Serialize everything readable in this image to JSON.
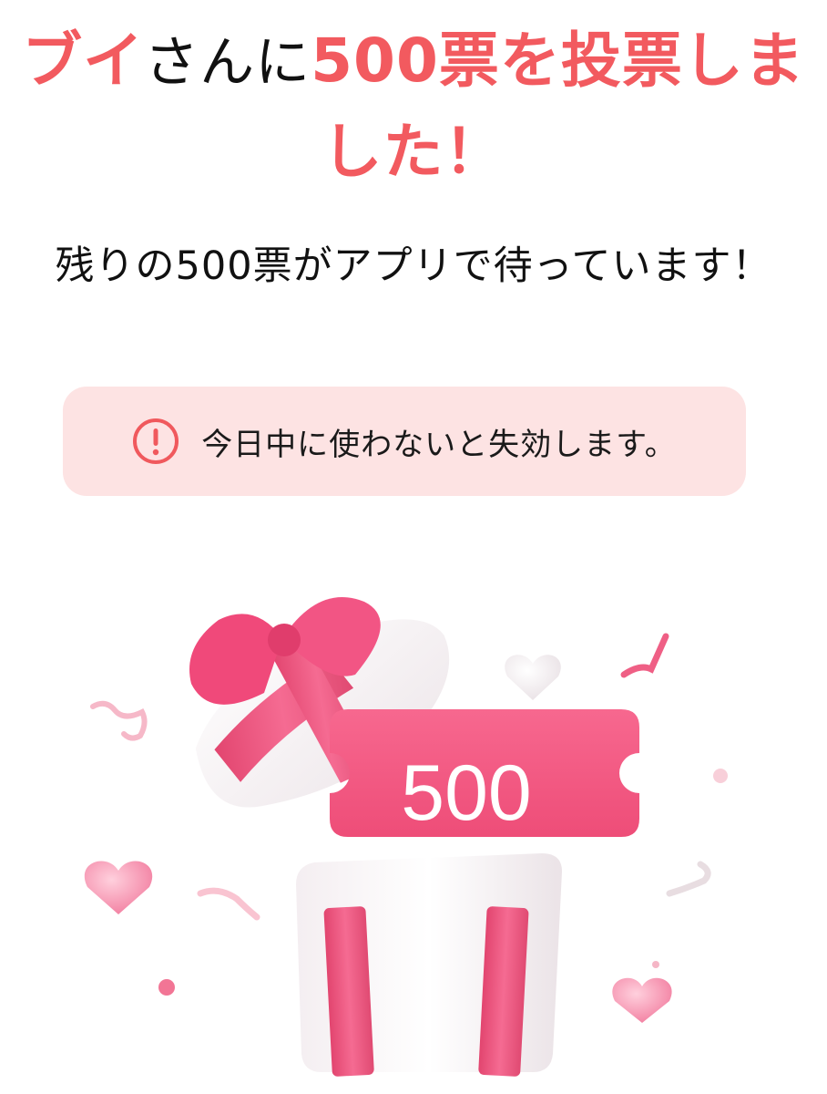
{
  "headline": {
    "name": "ブイ",
    "suffix": "さんに",
    "votes": "500票を投票しました！"
  },
  "subline": "残りの500票がアプリで待っています！",
  "warning": {
    "icon": "exclamation-circle-icon",
    "text": "今日中に使わないと失効します。"
  },
  "ticket": {
    "label": "500"
  },
  "colors": {
    "accent": "#f25a5f",
    "warning_bg": "#fde3e3",
    "ticket": "#f25680",
    "ribbon": "#f05a86"
  }
}
